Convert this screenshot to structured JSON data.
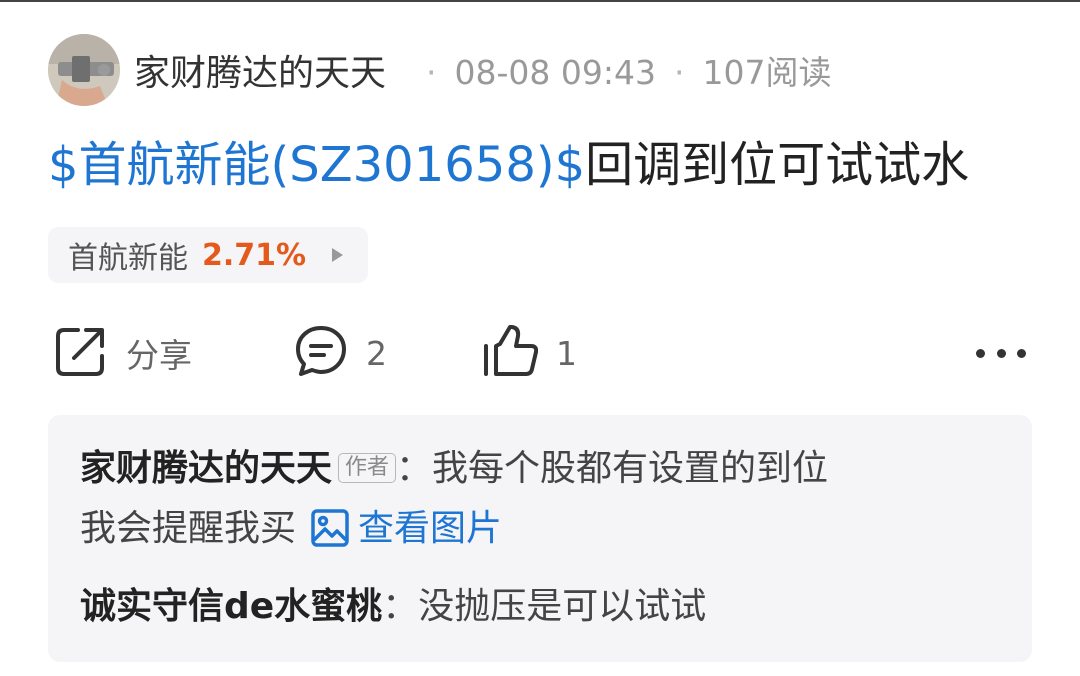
{
  "post": {
    "author": "家财腾达的天天",
    "time": "08-08 09:43",
    "reads": "107阅读",
    "title_link": "$首航新能(SZ301658)$",
    "title_rest": "回调到位可试试水"
  },
  "stock_tag": {
    "name": "首航新能",
    "change": "2.71%"
  },
  "actions": {
    "share_label": "分享",
    "comment_count": "2",
    "like_count": "1"
  },
  "comments": [
    {
      "user": "家财腾达的天天",
      "badge": "作者",
      "text_line1": "我每个股都有设置的到位",
      "text_line2": "我会提醒我买",
      "image_link": "查看图片"
    },
    {
      "user": "诚实守信de水蜜桃",
      "text": "没抛压是可以试试"
    }
  ],
  "colors": {
    "link": "#1e76d2",
    "up": "#e45a1c",
    "panel_bg": "#f5f5f7"
  }
}
